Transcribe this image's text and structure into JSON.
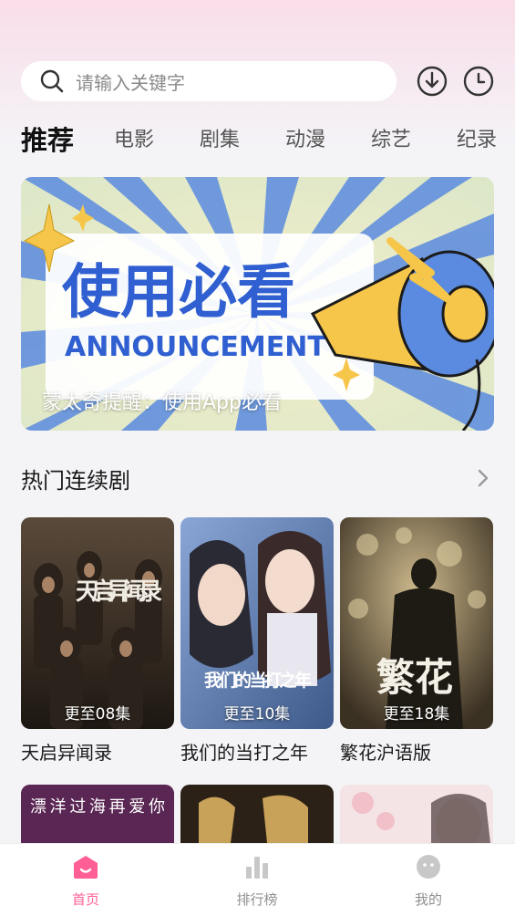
{
  "search": {
    "placeholder": "请输入关键字"
  },
  "header_actions": {
    "download_icon": "download-icon",
    "history_icon": "clock-icon"
  },
  "tabs": [
    {
      "label": "推荐",
      "active": true
    },
    {
      "label": "电影",
      "active": false
    },
    {
      "label": "剧集",
      "active": false
    },
    {
      "label": "动漫",
      "active": false
    },
    {
      "label": "综艺",
      "active": false
    },
    {
      "label": "纪录",
      "active": false
    }
  ],
  "banner": {
    "headline": "使用必看",
    "subheadline": "ANNOUNCEMENT",
    "caption": "蒙太奇提醒：使用App必看"
  },
  "section": {
    "title": "热门连续剧",
    "more_icon": "chevron-right-icon"
  },
  "shows": [
    {
      "title": "天启异闻录",
      "episodes": "更至08集",
      "poster_text": "天启异闻录"
    },
    {
      "title": "我们的当打之年",
      "episodes": "更至10集",
      "poster_text": "我们的当打之年"
    },
    {
      "title": "繁花沪语版",
      "episodes": "更至18集",
      "poster_text": "繁花"
    }
  ],
  "next_row": [
    {
      "poster_text": "漂洋过海再爱你"
    },
    {
      "poster_text": ""
    },
    {
      "poster_text": ""
    }
  ],
  "bottom_nav": [
    {
      "label": "首页",
      "icon": "home-icon",
      "active": true
    },
    {
      "label": "排行榜",
      "icon": "bar-chart-icon",
      "active": false
    },
    {
      "label": "我的",
      "icon": "profile-icon",
      "active": false
    }
  ],
  "colors": {
    "accent": "#ff5f95",
    "banner_blue": "#3f6fd8",
    "banner_yellow": "#f6c64a"
  }
}
